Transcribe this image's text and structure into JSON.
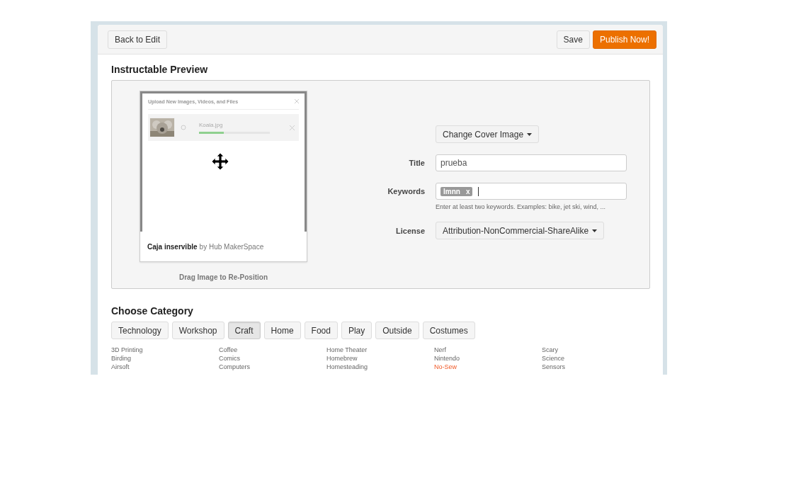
{
  "header": {
    "back_button": "Back to Edit",
    "save_button": "Save",
    "publish_button": "Publish Now!"
  },
  "preview": {
    "heading": "Instructable Preview",
    "dialog": {
      "title": "Upload New Images, Videos, and Files",
      "file_name": "Koala.jpg",
      "upload": {
        "level": 0.35
      }
    },
    "caption": {
      "title": "Caja inservible",
      "byline": "by Hub MakerSpace"
    },
    "drag_hint": "Drag Image to Re-Position",
    "cover_button": "Change Cover Image",
    "title_label": "Title",
    "title_value": "prueba",
    "keywords_label": "Keywords",
    "keywords": [
      {
        "label": "lmnn",
        "remove": "x"
      }
    ],
    "keywords_hint": "Enter at least two keywords. Examples: bike, jet ski, wind, ...",
    "license_label": "License",
    "license_value": "Attribution-NonCommercial-ShareAlike"
  },
  "category": {
    "heading": "Choose Category",
    "tabs": [
      {
        "label": "Technology",
        "selected": false
      },
      {
        "label": "Workshop",
        "selected": false
      },
      {
        "label": "Craft",
        "selected": true
      },
      {
        "label": "Home",
        "selected": false
      },
      {
        "label": "Food",
        "selected": false
      },
      {
        "label": "Play",
        "selected": false
      },
      {
        "label": "Outside",
        "selected": false
      },
      {
        "label": "Costumes",
        "selected": false
      }
    ],
    "columns": [
      [
        {
          "label": "3D Printing",
          "highlighted": false
        },
        {
          "label": "Birding",
          "highlighted": false
        },
        {
          "label": "Airsoft",
          "highlighted": false
        }
      ],
      [
        {
          "label": "Coffee",
          "highlighted": false
        },
        {
          "label": "Comics",
          "highlighted": false
        },
        {
          "label": "Computers",
          "highlighted": false
        }
      ],
      [
        {
          "label": "Home Theater",
          "highlighted": false
        },
        {
          "label": "Homebrew",
          "highlighted": false
        },
        {
          "label": "Homesteading",
          "highlighted": false
        }
      ],
      [
        {
          "label": "Nerf",
          "highlighted": false
        },
        {
          "label": "Nintendo",
          "highlighted": false
        },
        {
          "label": "No-Sew",
          "highlighted": true
        }
      ],
      [
        {
          "label": "Scary",
          "highlighted": false
        },
        {
          "label": "Science",
          "highlighted": false
        },
        {
          "label": "Sensors",
          "highlighted": false
        }
      ]
    ]
  }
}
